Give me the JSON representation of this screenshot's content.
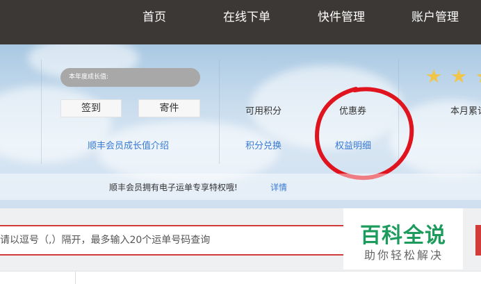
{
  "nav": {
    "items": [
      {
        "label": "首页"
      },
      {
        "label": "在线下单"
      },
      {
        "label": "快件管理"
      },
      {
        "label": "账户管理"
      }
    ]
  },
  "member": {
    "growth_label": "本年度成长值:",
    "sign_in_label": "签到",
    "send_label": "寄件",
    "growth_intro_link": "顺丰会员成长值介绍"
  },
  "points": {
    "available_label": "可用积分",
    "redeem_link": "积分兑换"
  },
  "coupons": {
    "label": "优惠券",
    "rights_link": "权益明细"
  },
  "monthly": {
    "label": "本月累计"
  },
  "notice": {
    "text": "顺丰会员拥有电子运单专享特权哦!",
    "detail_link": "详情"
  },
  "search": {
    "placeholder": "请以逗号（,）隔开，最多输入20个运单号码查询"
  },
  "watermark": {
    "main": "百科全说",
    "sub": "助你轻松解决"
  },
  "colors": {
    "nav_bg": "#3c3836",
    "link": "#3a7bd5",
    "annotation_circle": "#e0141e",
    "search_border": "#d33a3a",
    "watermark_green": "#1c9b5c"
  }
}
